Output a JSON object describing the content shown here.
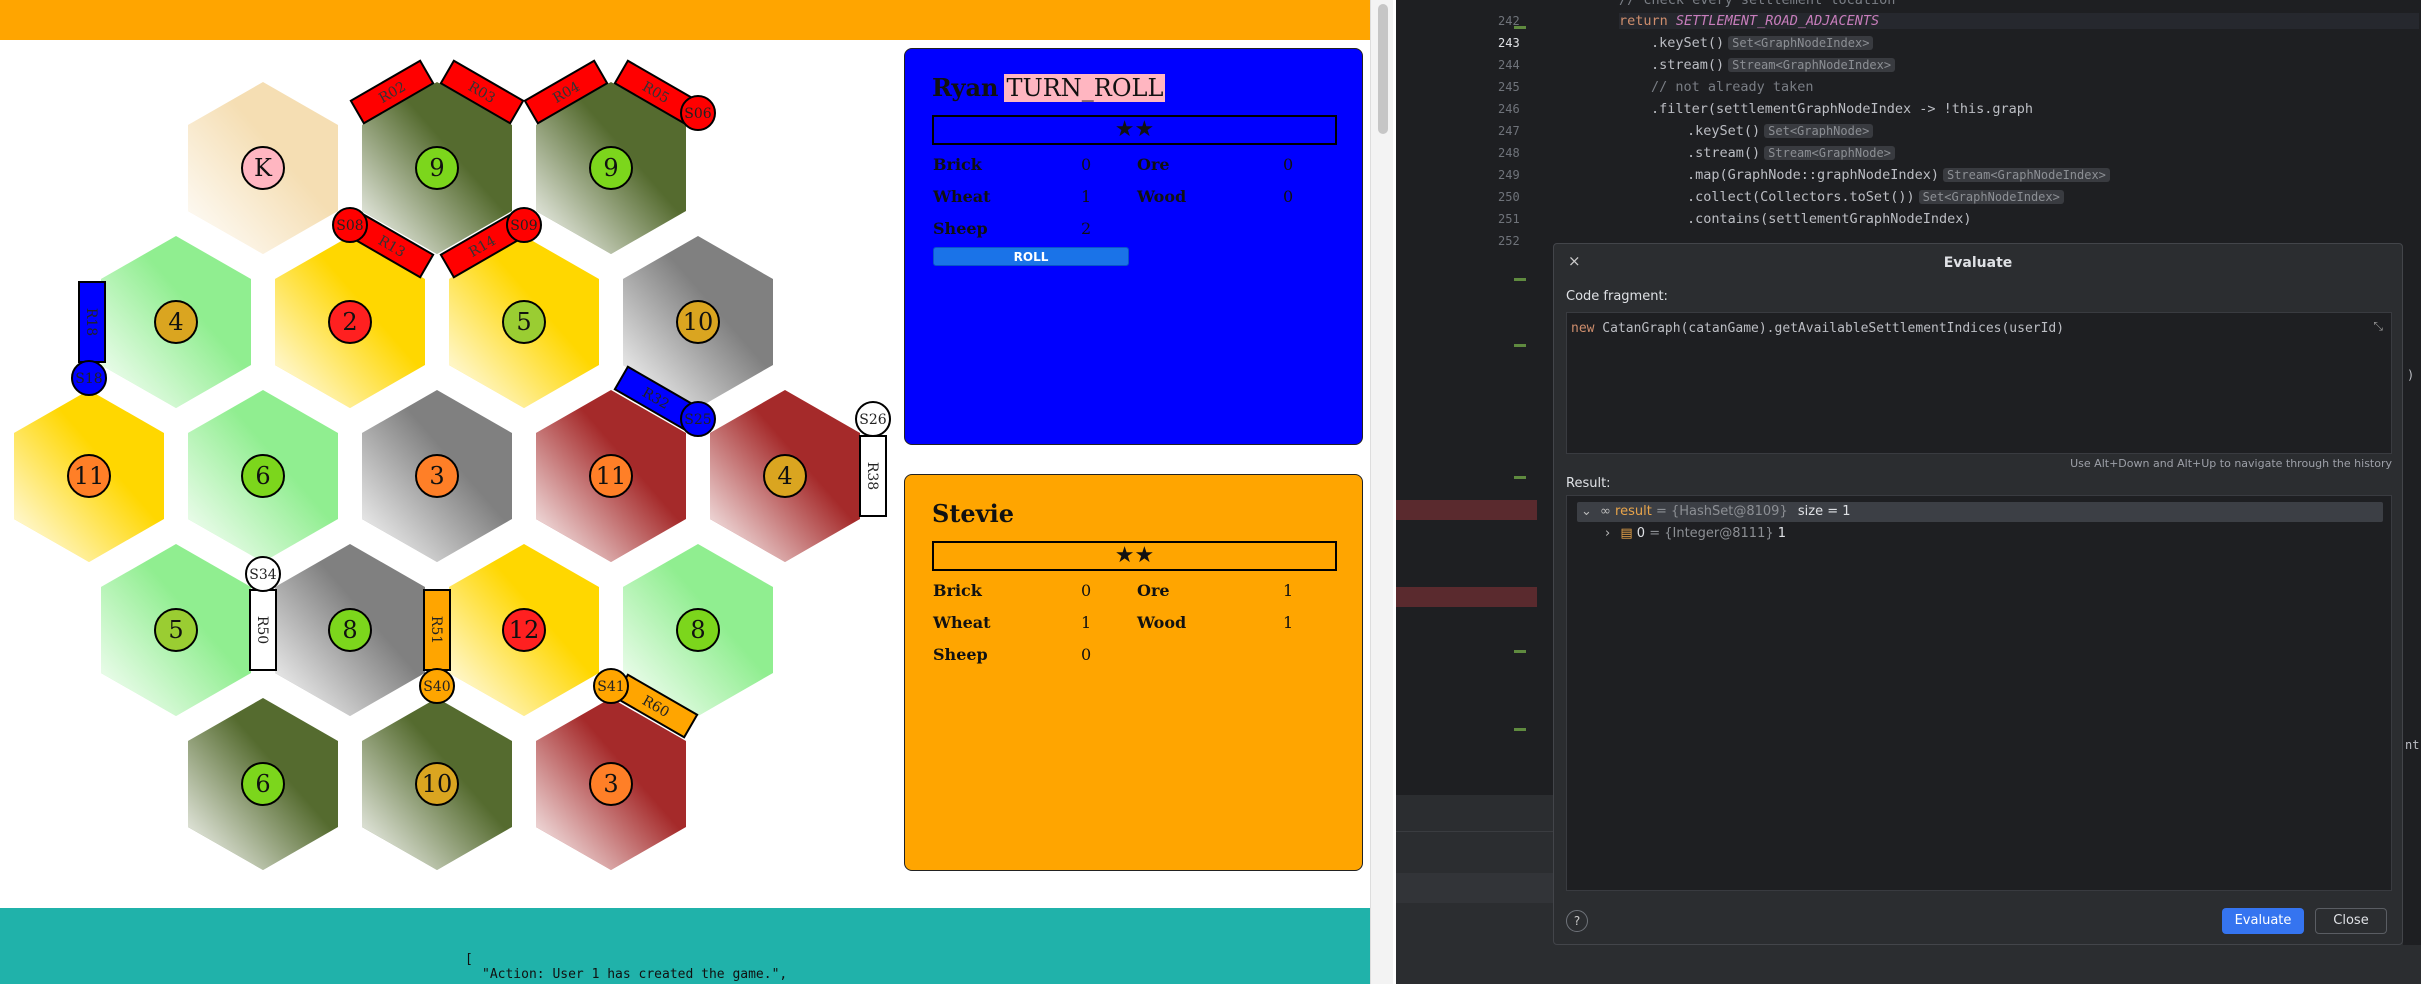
{
  "board": {
    "hexes": [
      {
        "color": "#f5deb3",
        "token": "K",
        "token_color": "#ffb6c1"
      },
      {
        "color": "#556b2f",
        "token": "9",
        "token_color": "#7cd61c"
      },
      {
        "color": "#556b2f",
        "token": "9",
        "token_color": "#7cd61c"
      },
      {
        "color": "#90ee90",
        "token": "4",
        "token_color": "#daa520"
      },
      {
        "color": "#ffd700",
        "token": "2",
        "token_color": "#ff2020"
      },
      {
        "color": "#ffd700",
        "token": "5",
        "token_color": "#9acd32"
      },
      {
        "color": "#808080",
        "token": "10",
        "token_color": "#daa520"
      },
      {
        "color": "#ffd700",
        "token": "11",
        "token_color": "#ff7f27"
      },
      {
        "color": "#90ee90",
        "token": "6",
        "token_color": "#7cd61c"
      },
      {
        "color": "#808080",
        "token": "3",
        "token_color": "#ff7f27"
      },
      {
        "color": "#a52a2a",
        "token": "11",
        "token_color": "#ff7f27"
      },
      {
        "color": "#a52a2a",
        "token": "4",
        "token_color": "#daa520"
      },
      {
        "color": "#90ee90",
        "token": "5",
        "token_color": "#9acd32"
      },
      {
        "color": "#808080",
        "token": "8",
        "token_color": "#7cd61c"
      },
      {
        "color": "#ffd700",
        "token": "12",
        "token_color": "#ff2020"
      },
      {
        "color": "#90ee90",
        "token": "8",
        "token_color": "#7cd61c"
      },
      {
        "color": "#556b2f",
        "token": "6",
        "token_color": "#7cd61c"
      },
      {
        "color": "#556b2f",
        "token": "10",
        "token_color": "#daa520"
      },
      {
        "color": "#a52a2a",
        "token": "3",
        "token_color": "#ff7f27"
      }
    ],
    "roads": [
      {
        "label": "R02",
        "color": "#ff0000"
      },
      {
        "label": "R03",
        "color": "#ff0000"
      },
      {
        "label": "R04",
        "color": "#ff0000"
      },
      {
        "label": "R05",
        "color": "#ff0000"
      },
      {
        "label": "R13",
        "color": "#ff0000"
      },
      {
        "label": "R14",
        "color": "#ff0000"
      },
      {
        "label": "R18",
        "color": "#0000ff"
      },
      {
        "label": "R32",
        "color": "#0000ff"
      },
      {
        "label": "R38",
        "color": "#ffffff"
      },
      {
        "label": "R50",
        "color": "#ffffff"
      },
      {
        "label": "R51",
        "color": "#ffa500"
      },
      {
        "label": "R60",
        "color": "#ffa500"
      }
    ],
    "settlements": [
      {
        "label": "S06",
        "color": "#ff0000"
      },
      {
        "label": "S08",
        "color": "#ff0000"
      },
      {
        "label": "S09",
        "color": "#ff0000"
      },
      {
        "label": "S18",
        "color": "#0000ff"
      },
      {
        "label": "S25",
        "color": "#0000ff"
      },
      {
        "label": "S26",
        "color": "#ffffff"
      },
      {
        "label": "S34",
        "color": "#ffffff"
      },
      {
        "label": "S40",
        "color": "#ffa500"
      },
      {
        "label": "S41",
        "color": "#ffa500"
      }
    ]
  },
  "players": [
    {
      "name": "Ryan",
      "state": "TURN_ROLL",
      "stars": "★★",
      "color": "#0000ff",
      "resources": [
        {
          "label": "Brick",
          "value": "0"
        },
        {
          "label": "Ore",
          "value": "0"
        },
        {
          "label": "Wheat",
          "value": "1"
        },
        {
          "label": "Wood",
          "value": "0"
        },
        {
          "label": "Sheep",
          "value": "2"
        }
      ],
      "roll_label": "ROLL"
    },
    {
      "name": "Stevie",
      "state": "",
      "stars": "★★",
      "color": "#ffa500",
      "resources": [
        {
          "label": "Brick",
          "value": "0"
        },
        {
          "label": "Ore",
          "value": "1"
        },
        {
          "label": "Wheat",
          "value": "1"
        },
        {
          "label": "Wood",
          "value": "1"
        },
        {
          "label": "Sheep",
          "value": "0"
        }
      ]
    }
  ],
  "log": {
    "open": "[",
    "line1": "\"Action: User 1 has created the game.\","
  },
  "ide": {
    "line_numbers": [
      "242",
      "243",
      "244",
      "245",
      "246",
      "247",
      "248",
      "249",
      "250",
      "251",
      "252"
    ],
    "code": [
      {
        "text": "// check every settlement location"
      },
      {
        "kw": "return ",
        "it": "SETTLEMENT_ROAD_ADJACENTS"
      },
      {
        "text": ".keySet()",
        "hint": "Set<GraphNodeIndex>"
      },
      {
        "text": ".stream()",
        "hint": "Stream<GraphNodeIndex>"
      },
      {
        "text": "// not already taken"
      },
      {
        "text": ".filter(settlementGraphNodeIndex -> !this.graph"
      },
      {
        "text": ".keySet()",
        "hint": "Set<GraphNode>"
      },
      {
        "text": ".stream()",
        "hint": "Stream<GraphNode>"
      },
      {
        "text": ".map(GraphNode::graphNodeIndex)",
        "hint": "Stream<GraphNodeIndex>"
      },
      {
        "text": ".collect(Collectors.toSet())",
        "hint": "Set<GraphNodeIndex>"
      },
      {
        "text": ".contains(settlementGraphNodeIndex)"
      }
    ],
    "right_text": [
      ")",
      "nt"
    ]
  },
  "dialog": {
    "title": "Evaluate",
    "close_x": "×",
    "fragment_label": "Code fragment:",
    "fragment_kw": "new",
    "fragment_code": " CatanGraph(catanGame).getAvailableSettlementIndices(userId)",
    "expand_icon": "⤡",
    "history_hint": "Use Alt+Down and Alt+Up to navigate through the history",
    "result_label": "Result:",
    "result_row": {
      "name": "result",
      "ref": "{HashSet@8109}",
      "size": "size = 1"
    },
    "result_child": {
      "name": "0",
      "ref": "{Integer@8111}",
      "value": "1"
    },
    "help": "?",
    "evaluate_btn": "Evaluate",
    "close_btn": "Close"
  }
}
